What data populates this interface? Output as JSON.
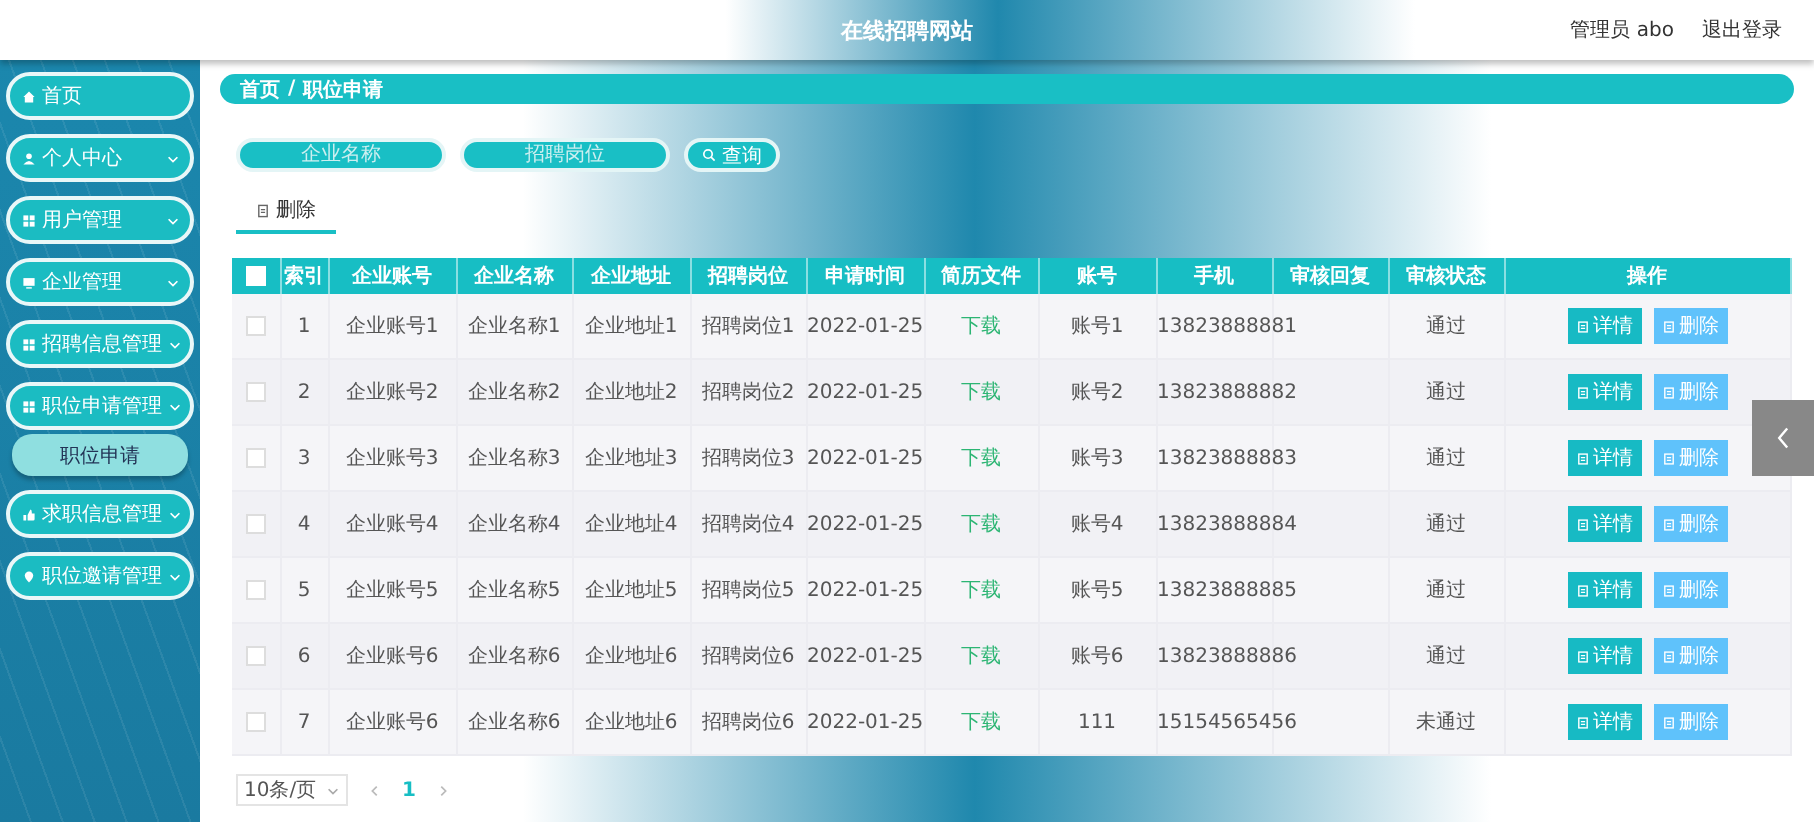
{
  "header": {
    "title": "在线招聘网站",
    "user": "管理员 abo",
    "logout": "退出登录"
  },
  "sidebar": {
    "items": [
      {
        "label": "首页",
        "has_submenu": false
      },
      {
        "label": "个人中心",
        "has_submenu": true
      },
      {
        "label": "用户管理",
        "has_submenu": true
      },
      {
        "label": "企业管理",
        "has_submenu": true
      },
      {
        "label": "招聘信息管理",
        "has_submenu": true
      },
      {
        "label": "职位申请管理",
        "has_submenu": true,
        "children": [
          {
            "label": "职位申请",
            "selected": true
          }
        ]
      },
      {
        "label": "求职信息管理",
        "has_submenu": true
      },
      {
        "label": "职位邀请管理",
        "has_submenu": true
      }
    ]
  },
  "breadcrumb": [
    "首页",
    "/",
    "职位申请"
  ],
  "search": {
    "fields": [
      {
        "placeholder": "企业名称"
      },
      {
        "placeholder": "招聘岗位"
      }
    ],
    "button": "查询"
  },
  "toolbar": {
    "delete": "删除"
  },
  "table": {
    "all_checked": false,
    "columns": [
      "索引",
      "企业账号",
      "企业名称",
      "企业地址",
      "招聘岗位",
      "申请时间",
      "简历文件",
      "账号",
      "手机",
      "审核回复",
      "审核状态",
      "操作"
    ],
    "rows": [
      {
        "checked": false,
        "cells": [
          "1",
          "企业账号1",
          "企业名称1",
          "企业地址1",
          "招聘岗位1",
          "2022-01-25",
          "下载",
          "账号1",
          "13823888881",
          "",
          "通过"
        ],
        "actions": [
          "详情",
          "删除"
        ]
      },
      {
        "checked": false,
        "cells": [
          "2",
          "企业账号2",
          "企业名称2",
          "企业地址2",
          "招聘岗位2",
          "2022-01-25",
          "下载",
          "账号2",
          "13823888882",
          "",
          "通过"
        ],
        "actions": [
          "详情",
          "删除"
        ]
      },
      {
        "checked": false,
        "cells": [
          "3",
          "企业账号3",
          "企业名称3",
          "企业地址3",
          "招聘岗位3",
          "2022-01-25",
          "下载",
          "账号3",
          "13823888883",
          "",
          "通过"
        ],
        "actions": [
          "详情",
          "删除"
        ]
      },
      {
        "checked": false,
        "cells": [
          "4",
          "企业账号4",
          "企业名称4",
          "企业地址4",
          "招聘岗位4",
          "2022-01-25",
          "下载",
          "账号4",
          "13823888884",
          "",
          "通过"
        ],
        "actions": [
          "详情",
          "删除"
        ]
      },
      {
        "checked": false,
        "cells": [
          "5",
          "企业账号5",
          "企业名称5",
          "企业地址5",
          "招聘岗位5",
          "2022-01-25",
          "下载",
          "账号5",
          "13823888885",
          "",
          "通过"
        ],
        "actions": [
          "详情",
          "删除"
        ]
      },
      {
        "checked": false,
        "cells": [
          "6",
          "企业账号6",
          "企业名称6",
          "企业地址6",
          "招聘岗位6",
          "2022-01-25",
          "下载",
          "账号6",
          "13823888886",
          "",
          "通过"
        ],
        "actions": [
          "详情",
          "删除"
        ]
      },
      {
        "checked": false,
        "cells": [
          "7",
          "企业账号6",
          "企业名称6",
          "企业地址6",
          "招聘岗位6",
          "2022-01-25",
          "下载",
          "111",
          "15154565456",
          "",
          "未通过"
        ],
        "actions": [
          "详情",
          "删除"
        ]
      }
    ]
  },
  "pagination": {
    "page_size": "10条/页",
    "page": "1"
  }
}
